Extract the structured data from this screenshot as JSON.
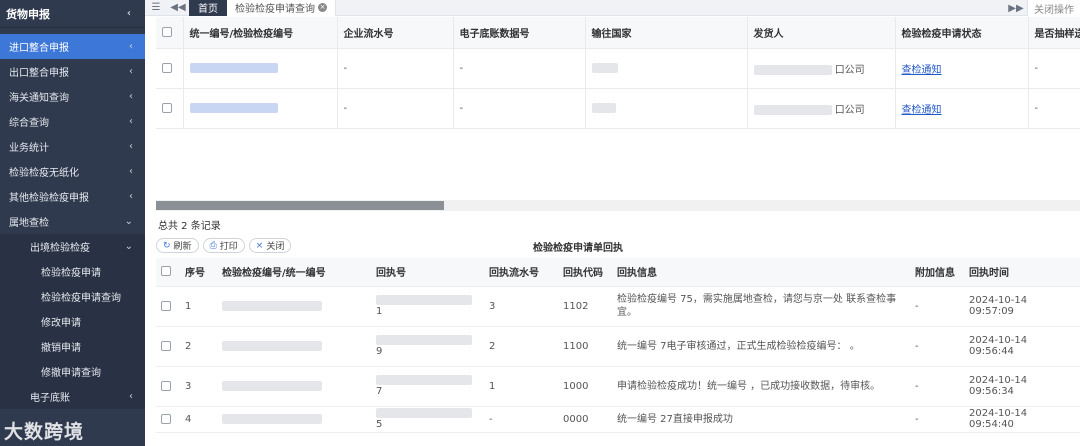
{
  "sidebar": {
    "header": "货物申报",
    "items": [
      {
        "label": "进口整合申报"
      },
      {
        "label": "出口整合申报"
      },
      {
        "label": "海关通知查询"
      },
      {
        "label": "综合查询"
      },
      {
        "label": "业务统计"
      },
      {
        "label": "检验检疫无纸化"
      },
      {
        "label": "其他检验检疫申报"
      },
      {
        "label": "属地查检"
      }
    ],
    "sub_group": "出境检验检疫",
    "leaves": [
      {
        "label": "检验检疫申请"
      },
      {
        "label": "检验检疫申请查询"
      },
      {
        "label": "修改申请"
      },
      {
        "label": "撤销申请"
      },
      {
        "label": "修撤申请查询"
      }
    ],
    "more_item": "电子底账",
    "watermark": "大数跨境"
  },
  "tabbar": {
    "home": "首页",
    "current": "检验检疫申请查询",
    "close_ops": "关闭操作"
  },
  "upper_table": {
    "columns": [
      "统一编号/检验检疫编号",
      "企业流水号",
      "电子底账数据号",
      "输往国家",
      "发货人",
      "检验检疫申请状态",
      "是否抽样送"
    ],
    "rows": [
      {
        "enterprise_serial": "-",
        "ebook_no": "-",
        "consignor_suffix": "口公司",
        "status": "查检通知",
        "sampled": "-"
      },
      {
        "enterprise_serial": "-",
        "ebook_no": "-",
        "consignor_suffix": "口公司",
        "status": "查检通知",
        "sampled": "-"
      }
    ],
    "total_text": "总共 2 条记录"
  },
  "actions": {
    "refresh": "刷新",
    "print": "打印",
    "close": "关闭"
  },
  "receipt": {
    "title": "检验检疫申请单回执",
    "columns": [
      "序号",
      "检验检疫编号/统一编号",
      "回执号",
      "回执流水号",
      "回执代码",
      "回执信息",
      "附加信息",
      "回执时间"
    ],
    "rows": [
      {
        "no": "1",
        "id_tail": "",
        "receipt_tail": "1",
        "serial": "3",
        "code": "1102",
        "info": "检验检疫编号 75，需实施属地查检，请您与京一处 联系查检事宜。",
        "extra": "-",
        "time": "2024-10-14 09:57:09"
      },
      {
        "no": "2",
        "id_tail": "",
        "receipt_tail": "9",
        "serial": "2",
        "code": "1100",
        "info": "统一编号 7电子审核通过，正式生成检验检疫编号： 。",
        "extra": "-",
        "time": "2024-10-14 09:56:44"
      },
      {
        "no": "3",
        "id_tail": "",
        "receipt_tail": "7",
        "serial": "1",
        "code": "1000",
        "info": "申请检验检疫成功！统一编号 ，已成功接收数据，待审核。",
        "extra": "-",
        "time": "2024-10-14 09:56:34"
      },
      {
        "no": "4",
        "id_tail": "",
        "receipt_tail": "5",
        "serial": "-",
        "code": "0000",
        "info": "统一编号 27直接申报成功",
        "extra": "-",
        "time": "2024-10-14 09:54:40"
      }
    ]
  }
}
